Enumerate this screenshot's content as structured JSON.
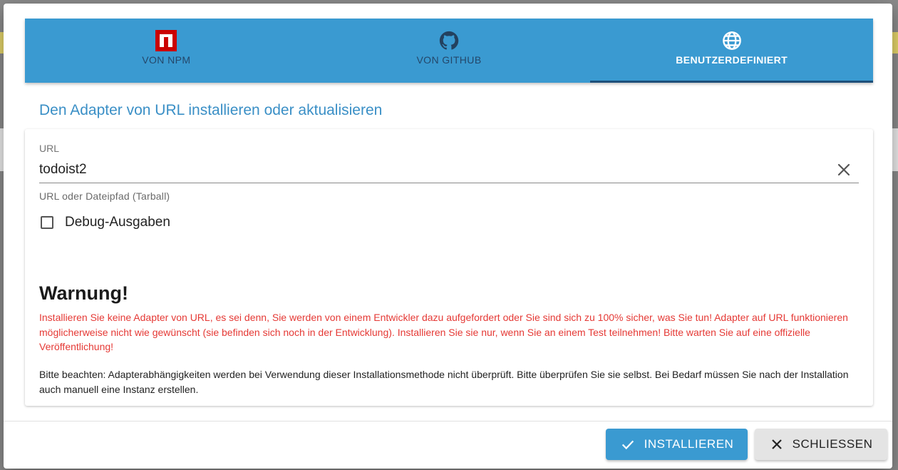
{
  "tabs": [
    {
      "label": "VON NPM",
      "icon": "npm-icon"
    },
    {
      "label": "VON GITHUB",
      "icon": "github-icon"
    },
    {
      "label": "BENUTZERDEFINIERT",
      "icon": "globe-icon"
    }
  ],
  "active_tab": 2,
  "section_title": "Den Adapter von URL installieren oder aktualisieren",
  "url_field": {
    "label": "URL",
    "value": "todoist2",
    "helper": "URL oder Dateipfad (Tarball)"
  },
  "debug_checkbox": {
    "label": "Debug-Ausgaben",
    "checked": false
  },
  "warning": {
    "title": "Warnung!",
    "text": "Installieren Sie keine Adapter von URL, es sei denn, Sie werden von einem Entwickler dazu aufgefordert oder Sie sind sich zu 100% sicher, was Sie tun! Adapter auf URL funktionieren möglicherweise nicht wie gewünscht (sie befinden sich noch in der Entwicklung). Installieren Sie sie nur, wenn Sie an einem Test teilnehmen! Bitte warten Sie auf eine offizielle Veröffentlichung!"
  },
  "note": "Bitte beachten: Adapterabhängigkeiten werden bei Verwendung dieser Installationsmethode nicht überprüft. Bitte überprüfen Sie sie selbst. Bei Bedarf müssen Sie nach der Installation auch manuell eine Instanz erstellen.",
  "buttons": {
    "install": "INSTALLIEREN",
    "close": "SCHLIESSEN"
  },
  "colors": {
    "accent": "#3a9ad1",
    "warning": "#e53935",
    "npm_red": "#cb0000"
  }
}
